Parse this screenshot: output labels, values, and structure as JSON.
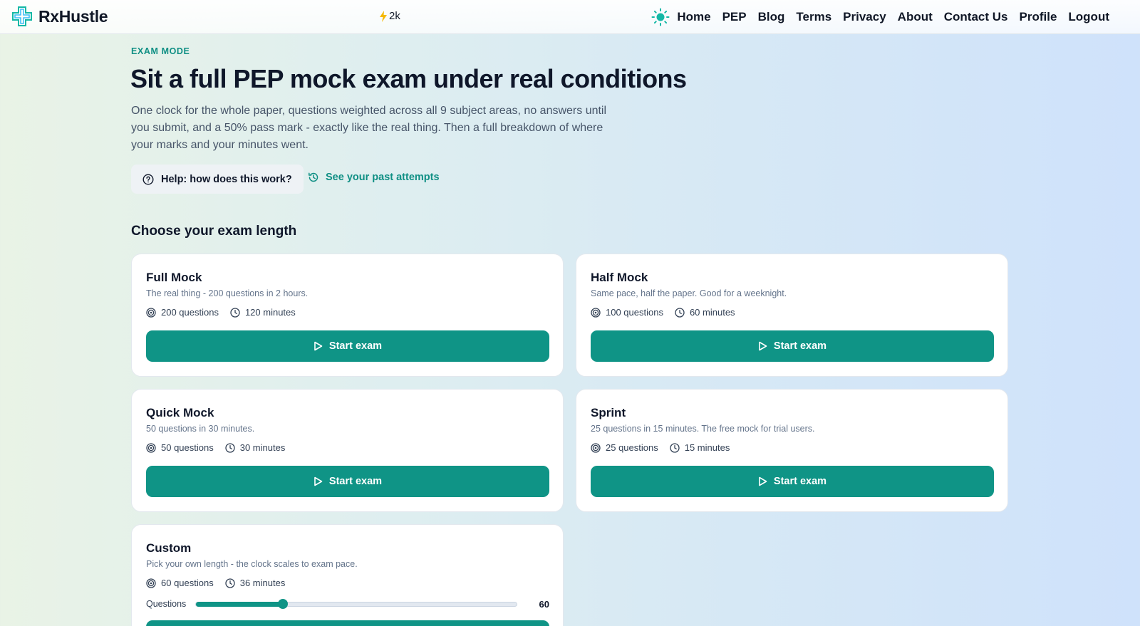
{
  "nav": {
    "brand": "RxHustle",
    "streak": "2k",
    "links": [
      "Home",
      "PEP",
      "Blog",
      "Terms",
      "Privacy",
      "About",
      "Contact Us",
      "Profile",
      "Logout"
    ]
  },
  "hero": {
    "eyebrow": "EXAM MODE",
    "title": "Sit a full PEP mock exam under real conditions",
    "description": "One clock for the whole paper, questions weighted across all 9 subject areas, no answers until you submit, and a 50% pass mark - exactly like the real thing. Then a full breakdown of where your marks and your minutes went.",
    "help_label": "Help: how does this work?",
    "past_attempts_label": "See your past attempts"
  },
  "section": {
    "title": "Choose your exam length"
  },
  "cards": [
    {
      "title": "Full Mock",
      "desc": "The real thing - 200 questions in 2 hours.",
      "questions": "200 questions",
      "minutes": "120 minutes",
      "button": "Start exam"
    },
    {
      "title": "Half Mock",
      "desc": "Same pace, half the paper. Good for a weeknight.",
      "questions": "100 questions",
      "minutes": "60 minutes",
      "button": "Start exam"
    },
    {
      "title": "Quick Mock",
      "desc": "50 questions in 30 minutes.",
      "questions": "50 questions",
      "minutes": "30 minutes",
      "button": "Start exam"
    },
    {
      "title": "Sprint",
      "desc": "25 questions in 15 minutes. The free mock for trial users.",
      "questions": "25 questions",
      "minutes": "15 minutes",
      "button": "Start exam"
    }
  ],
  "custom": {
    "title": "Custom",
    "desc": "Pick your own length - the clock scales to exam pace.",
    "questions": "60 questions",
    "minutes": "36 minutes",
    "slider_label": "Questions",
    "slider_value": "60",
    "slider_fraction": 0.27
  },
  "colors": {
    "accent": "#0f9486",
    "accent_text": "#0f8f84",
    "streak": "#f5b800"
  }
}
